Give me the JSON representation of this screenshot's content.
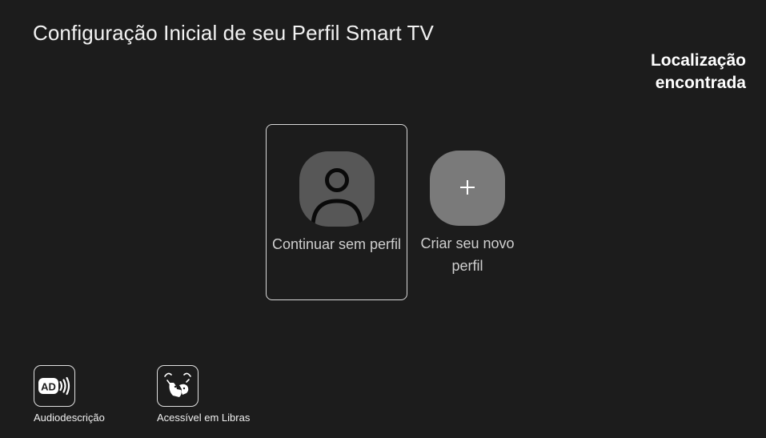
{
  "header": {
    "title": "Configuração Inicial de seu Perfil Smart TV",
    "location_status": "Localização encontrada"
  },
  "profiles": [
    {
      "label": "Continuar sem perfil",
      "icon": "person-icon",
      "selected": true
    },
    {
      "label": "Criar seu novo perfil",
      "icon": "plus-icon",
      "selected": false
    }
  ],
  "accessibility": [
    {
      "label": "Audiodescrição",
      "icon": "audio-description-icon",
      "icon_text": "AD"
    },
    {
      "label": "Acessível em Libras",
      "icon": "sign-language-icon"
    }
  ],
  "colors": {
    "background": "#1c1c1c",
    "selected_border": "#d8d8d8",
    "avatar_dark": "#575757",
    "avatar_light": "#7a7a7a",
    "text": "#ffffff"
  }
}
